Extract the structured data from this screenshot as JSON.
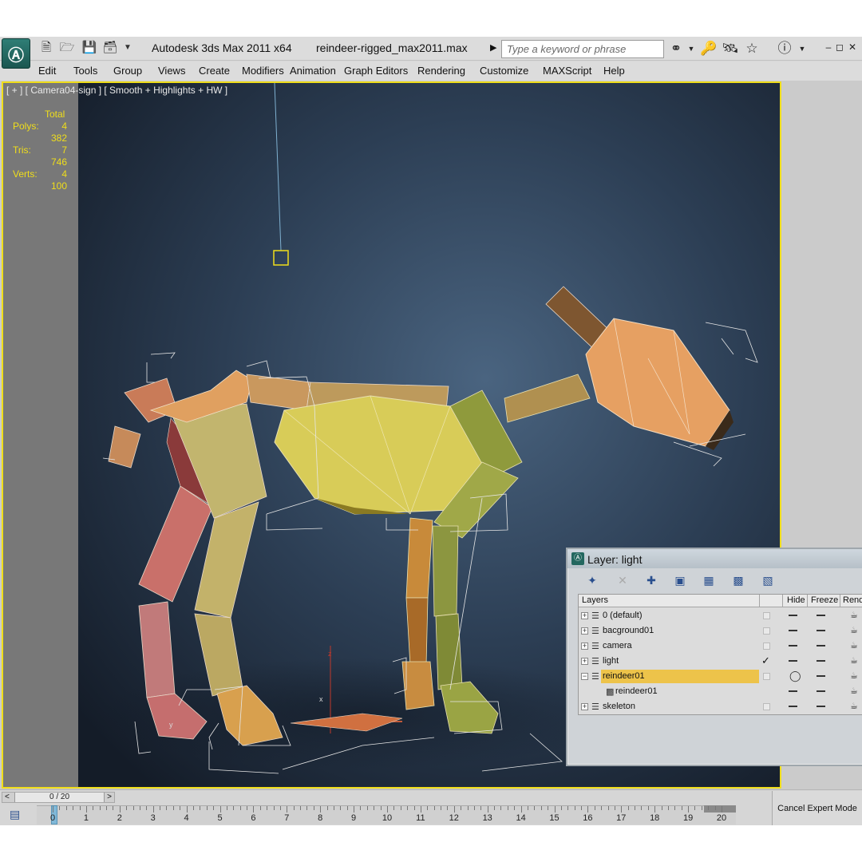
{
  "title_bar": {
    "app_title": "Autodesk 3ds Max  2011 x64",
    "file_name": "reindeer-rigged_max2011.max",
    "search_placeholder": "Type a keyword or phrase",
    "icons": [
      "new-file-icon",
      "open-folder-icon",
      "save-icon",
      "project-folder-icon",
      "dropdown-arrow-icon",
      "binoculars-icon",
      "key-icon",
      "satellite-icon",
      "star-icon",
      "help-icon"
    ]
  },
  "menu": {
    "items": [
      "Edit",
      "Tools",
      "Group",
      "Views",
      "Create",
      "Modifiers",
      "Animation",
      "Graph Editors",
      "Rendering",
      "Customize",
      "MAXScript",
      "Help"
    ]
  },
  "viewport": {
    "label": "[ + ] [ Camera04-sign ] [ Smooth + Highlights + HW ]",
    "stats": {
      "total_label": "Total",
      "polys_label": "Polys:",
      "polys_value": "4 382",
      "tris_label": "Tris:",
      "tris_value": "7 746",
      "verts_label": "Verts:",
      "verts_value": "4 100"
    },
    "axis_labels": {
      "z": "z",
      "x": "x",
      "y": "y"
    },
    "active_border_color": "#f0de1a"
  },
  "layer_dialog": {
    "title": "Layer: light",
    "columns": {
      "layers": "Layers",
      "hide": "Hide",
      "freeze": "Freeze",
      "render": "Render"
    },
    "rows": [
      {
        "name": "0 (default)",
        "expander": "+",
        "current": false,
        "hidden": false
      },
      {
        "name": "bacground01",
        "expander": "+",
        "current": false,
        "hidden": false
      },
      {
        "name": "camera",
        "expander": "+",
        "current": false,
        "hidden": false
      },
      {
        "name": "light",
        "expander": "+",
        "current": true,
        "hidden": false
      },
      {
        "name": "reindeer01",
        "expander": "−",
        "current": false,
        "hidden": false,
        "selected": true
      },
      {
        "name": "reindeer01",
        "expander": "",
        "current": false,
        "hidden": false,
        "child": true
      },
      {
        "name": "skeleton",
        "expander": "+",
        "current": false,
        "hidden": false
      }
    ],
    "selected_color": "#edc34a"
  },
  "timeline": {
    "frame_display": "0 / 20",
    "slider_left": "<",
    "slider_right": ">",
    "ticks": [
      "0",
      "1",
      "2",
      "3",
      "4",
      "5",
      "6",
      "7",
      "8",
      "9",
      "10",
      "11",
      "12",
      "13",
      "14",
      "15",
      "16",
      "17",
      "18",
      "19",
      "20"
    ],
    "current_frame": 0,
    "expert_button": "Cancel Expert Mode"
  }
}
